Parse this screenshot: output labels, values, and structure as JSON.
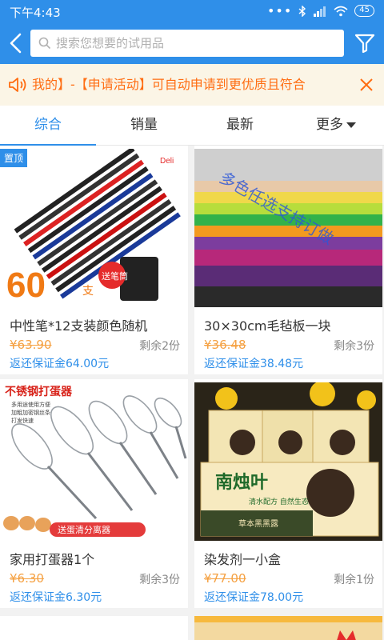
{
  "status": {
    "time": "下午4:43",
    "battery": "45"
  },
  "search": {
    "placeholder": "搜索您想要的试用品"
  },
  "notice": {
    "text": "我的】-【申请活动】可自动申请到更优质且符合"
  },
  "tabs": [
    {
      "label": "综合"
    },
    {
      "label": "销量"
    },
    {
      "label": "最新"
    },
    {
      "label": "更多"
    }
  ],
  "products": [
    {
      "badge": "置顶",
      "name": "中性笔*12支装颜色随机",
      "price": "¥63.90",
      "remain": "剩余2份",
      "refund": "返还保证金64.00元",
      "image": {
        "big_text": "60",
        "unit": "支",
        "brand": "Deli",
        "tag": "送笔筒"
      }
    },
    {
      "name": "30×30cm毛毡板一块",
      "price": "¥36.48",
      "remain": "剩余3份",
      "refund": "返还保证金38.48元",
      "image": {
        "watermark": "多色任选支持订做"
      }
    },
    {
      "name": "家用打蛋器1个",
      "price": "¥6.30",
      "remain": "剩余3份",
      "refund": "返还保证金6.30元",
      "image": {
        "title": "不锈钢打蛋器",
        "features": [
          "多用途使用方便",
          "加粗加密钢丝条",
          "打发快速"
        ],
        "banner": "送蛋清分离器"
      }
    },
    {
      "name": "染发剂一小盒",
      "price": "¥77.00",
      "remain": "剩余1份",
      "refund": "返还保证金78.00元",
      "image": {
        "brand": "南烛叶",
        "sub": "清水配方 自然生态",
        "tagline": "草本黑黑露"
      }
    }
  ],
  "colors": {
    "primary": "#2f8fe9",
    "price": "#f5a142",
    "notice": "#ff6d12",
    "notice_bg": "#fbf5e6"
  },
  "icons": [
    "back-icon",
    "search-icon",
    "filter-icon",
    "speaker-icon",
    "close-icon",
    "caret-down-icon"
  ]
}
